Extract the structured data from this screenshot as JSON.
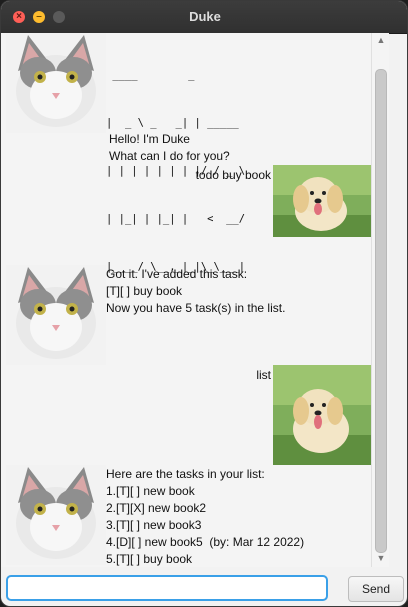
{
  "window": {
    "title": "Duke"
  },
  "messages": [
    {
      "sender": "duke",
      "logo": [
        " ____        _        ",
        "|  _ \\ _   _| | _____ ",
        "| | | | | | | |/ / _ \\",
        "| |_| | |_| |   <  __/",
        "|____/ \\__,_|_|\\_\\___|"
      ]
    },
    {
      "sender": "duke",
      "text": "Hello! I'm Duke\nWhat can I do for you?"
    },
    {
      "sender": "user",
      "text": "todo buy book"
    },
    {
      "sender": "duke",
      "text": "Got it. I've added this task:\n[T][ ] buy book\nNow you have 5 task(s) in the list."
    },
    {
      "sender": "user",
      "text": "list"
    },
    {
      "sender": "duke",
      "text": "Here are the tasks in your list:\n1.[T][ ] new book\n2.[T][X] new book2\n3.[T][ ] new book3\n4.[D][ ] new book5  (by: Mar 12 2022)\n5.[T][ ] buy book"
    }
  ],
  "input": {
    "value": "",
    "placeholder": ""
  },
  "send_label": "Send"
}
